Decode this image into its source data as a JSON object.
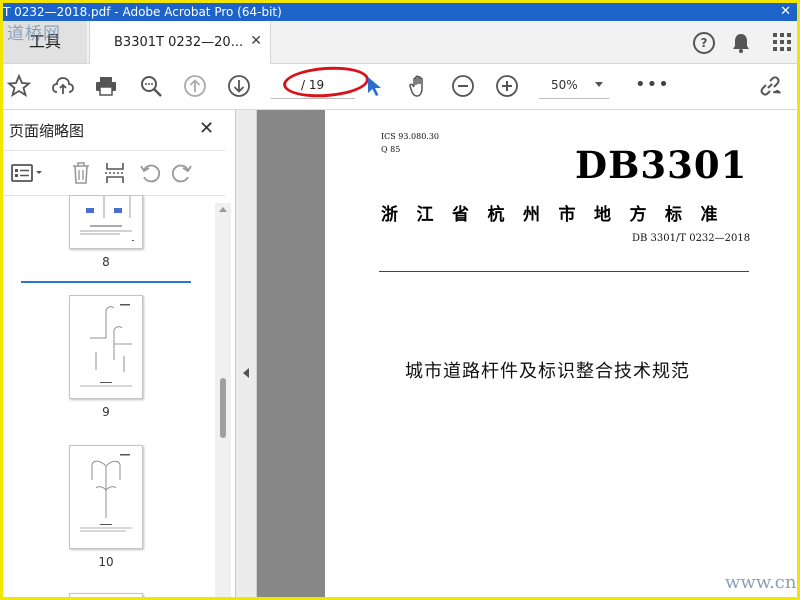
{
  "window": {
    "title": "T 0232—2018.pdf - Adobe Acrobat Pro (64-bit)",
    "close_glyph": "✕"
  },
  "tabs": {
    "watermark_logo": "道桥网",
    "tools_label": "工具",
    "document_label": "B3301T 0232—20...",
    "close_glyph": "✕",
    "help_glyph": "?"
  },
  "toolbar": {
    "page_count": "/ 19",
    "zoom_value": "50%",
    "more_glyph": "•••"
  },
  "thumbnail_panel": {
    "title": "页面缩略图",
    "close_glyph": "✕",
    "thumbnails": [
      {
        "label": "8"
      },
      {
        "label": "9"
      },
      {
        "label": "10"
      }
    ]
  },
  "document": {
    "ics": "ICS 93.080.30",
    "class_code": "Q 85",
    "db_code": "DB3301",
    "province": "浙江省杭州市地方标准",
    "standard_number": "DB 3301/T 0232—2018",
    "standard_title": "城市道路杆件及标识整合技术规范",
    "site_watermark": "www.cndao.com"
  },
  "colors": {
    "frame_border": "#f2e600",
    "titlebar": "#1e63c9",
    "annotation_ellipse": "#d8121a",
    "selection_bar": "#2b74d9"
  }
}
